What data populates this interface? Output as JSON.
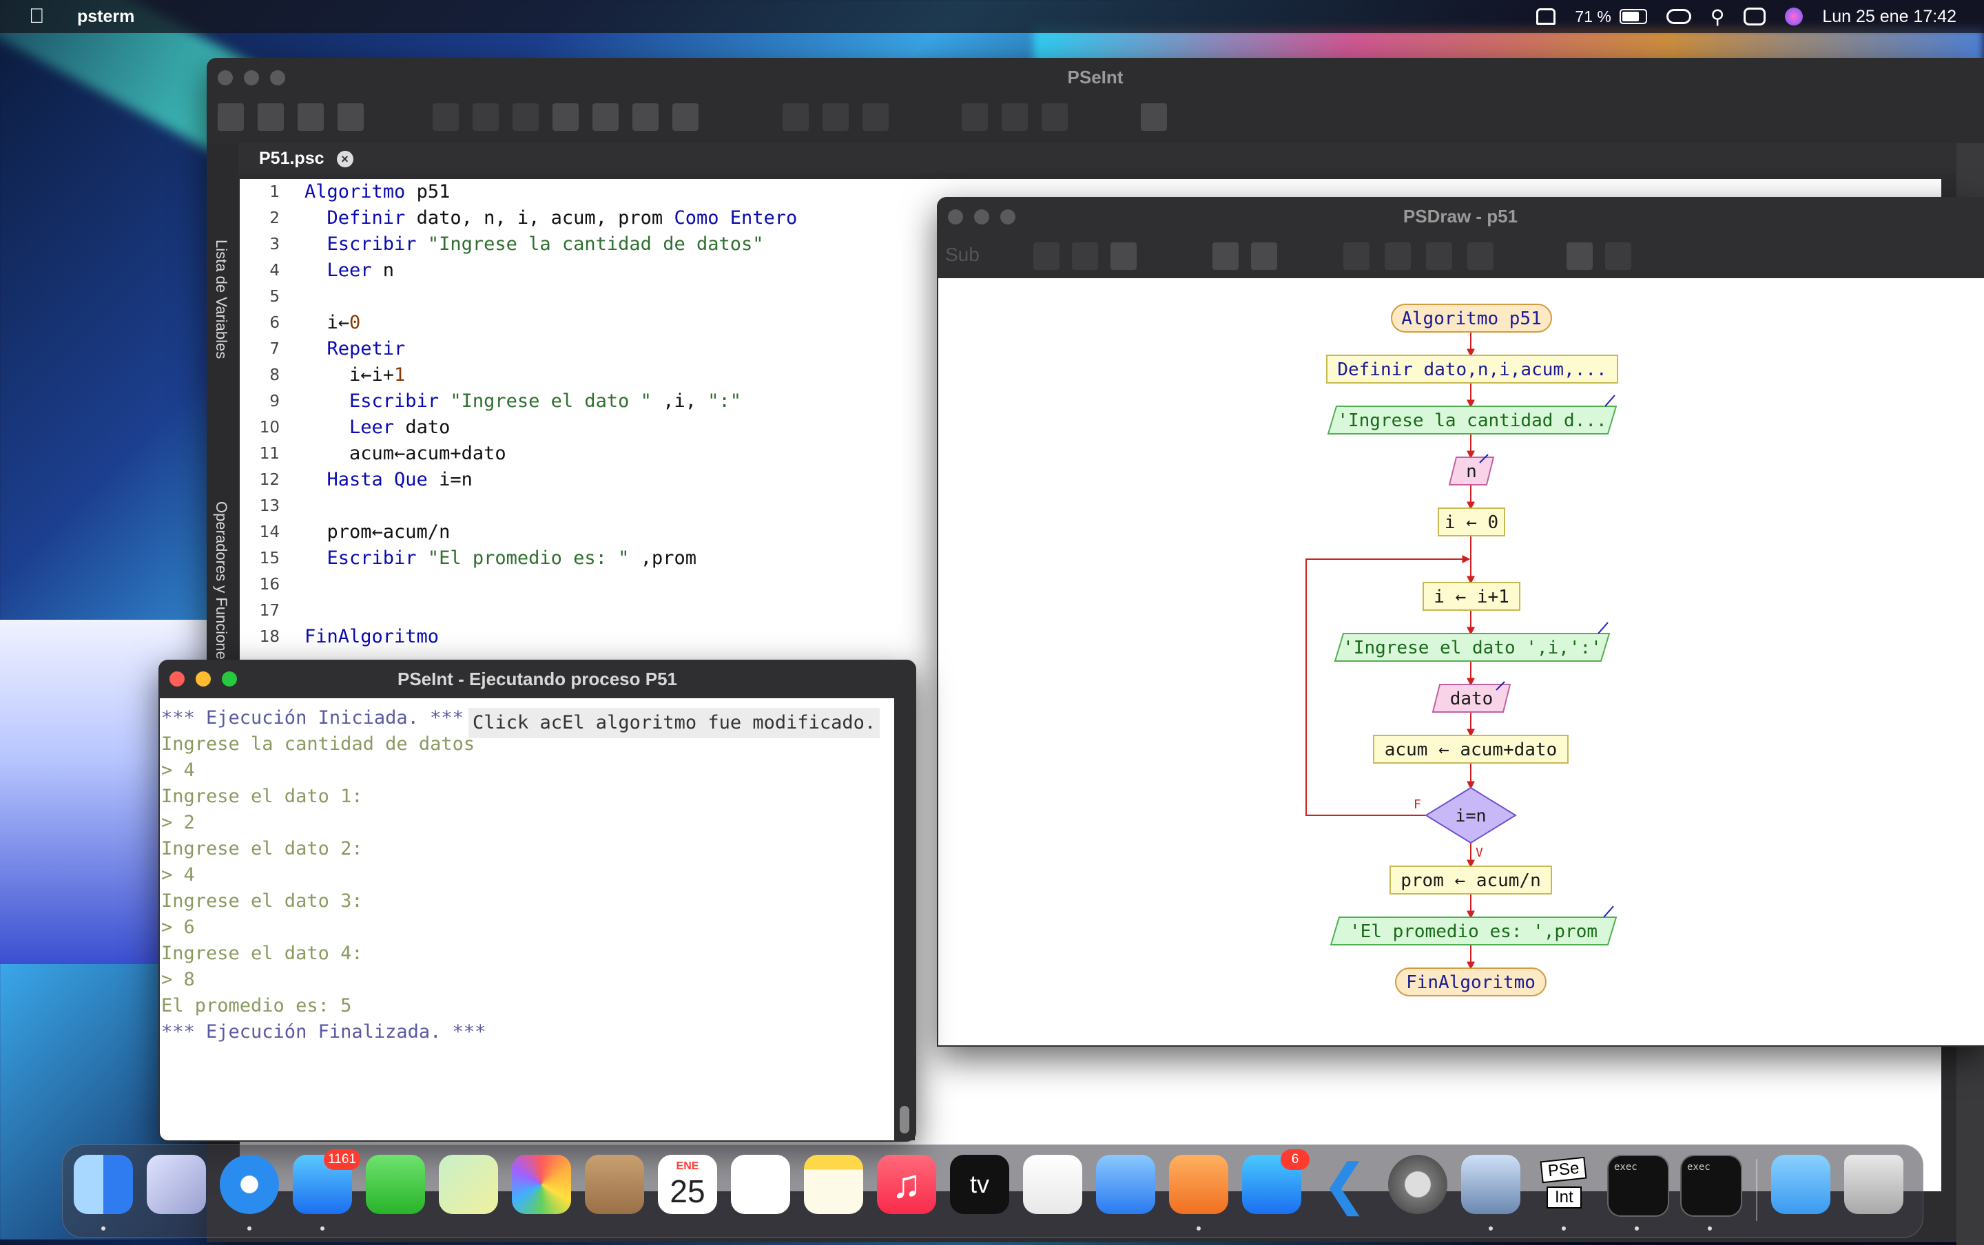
{
  "menubar": {
    "app_name": "psterm",
    "battery": "71 %",
    "datetime": "Lun 25 ene  17:42"
  },
  "pseint": {
    "title": "PSeInt",
    "tab_name": "P51.psc",
    "side_labels": [
      "Lista de Variables",
      "Operadores y Funciones"
    ],
    "code_lines": [
      {
        "n": "1",
        "text": "Algoritmo p51"
      },
      {
        "n": "2",
        "text": "  Definir dato, n, i, acum, prom Como Entero"
      },
      {
        "n": "3",
        "text": "  Escribir \"Ingrese la cantidad de datos\""
      },
      {
        "n": "4",
        "text": "  Leer n"
      },
      {
        "n": "5",
        "text": ""
      },
      {
        "n": "6",
        "text": "  i←0"
      },
      {
        "n": "7",
        "text": "  Repetir"
      },
      {
        "n": "8",
        "text": "    i←i+1"
      },
      {
        "n": "9",
        "text": "    Escribir \"Ingrese el dato \" ,i, \":\""
      },
      {
        "n": "10",
        "text": "    Leer dato"
      },
      {
        "n": "11",
        "text": "    acum←acum+dato"
      },
      {
        "n": "12",
        "text": "  Hasta Que i=n"
      },
      {
        "n": "13",
        "text": ""
      },
      {
        "n": "14",
        "text": "  prom←acum/n"
      },
      {
        "n": "15",
        "text": "  Escribir \"El promedio es: \" ,prom"
      },
      {
        "n": "16",
        "text": ""
      },
      {
        "n": "17",
        "text": ""
      },
      {
        "n": "18",
        "text": "FinAlgoritmo"
      }
    ]
  },
  "psdraw": {
    "title": "PSDraw - p51",
    "toolbar_sub": "Sub",
    "nodes": {
      "start": "Algoritmo p51",
      "define": "Definir dato,n,i,acum,...",
      "write1": "'Ingrese la cantidad d...",
      "read_n": "n",
      "assign_i0": "i ← 0",
      "assign_i1": "i ← i+1",
      "write2": "'Ingrese el dato ',i,':'",
      "read_dato": "dato",
      "assign_acum": "acum ← acum+dato",
      "cond": "i=n",
      "cond_false": "F",
      "cond_true": "V",
      "assign_prom": "prom ← acum/n",
      "write3": "'El promedio es: ',prom",
      "end": "FinAlgoritmo"
    }
  },
  "exec": {
    "title": "PSeInt - Ejecutando proceso P51",
    "tooltip": "Click acEl algoritmo fue modificado.",
    "lines": [
      {
        "t": "*** Ejecución Iniciada. ***",
        "k": "sys"
      },
      {
        "t": "Ingrese la cantidad de datos",
        "k": "out"
      },
      {
        "t": "> 4",
        "k": "in"
      },
      {
        "t": "Ingrese el dato 1:",
        "k": "out"
      },
      {
        "t": "> 2",
        "k": "in"
      },
      {
        "t": "Ingrese el dato 2:",
        "k": "out"
      },
      {
        "t": "> 4",
        "k": "in"
      },
      {
        "t": "Ingrese el dato 3:",
        "k": "out"
      },
      {
        "t": "> 6",
        "k": "in"
      },
      {
        "t": "Ingrese el dato 4:",
        "k": "out"
      },
      {
        "t": "> 8",
        "k": "in"
      },
      {
        "t": "El promedio es: 5",
        "k": "out"
      },
      {
        "t": "*** Ejecución Finalizada. ***",
        "k": "sys"
      }
    ]
  },
  "dock": {
    "mail_badge": "1161",
    "appstore_badge": "6",
    "calendar_month": "ENE",
    "calendar_day": "25",
    "tv_label": "tv",
    "pseint_label_top": "PSe",
    "pseint_label_bottom": "Int",
    "exec_label": "exec"
  },
  "colors": {
    "keyword": "#0a0ab0",
    "string": "#2f6f2f",
    "console_sys": "#5a5aa0",
    "console_out": "#8a9a60",
    "flow_line": "#d02020",
    "flow_start": "#fde9c4",
    "flow_box": "#fffbd0",
    "flow_io": "#d9f7d9",
    "flow_read": "#f9d4e8",
    "flow_cond": "#c8b8f8"
  }
}
